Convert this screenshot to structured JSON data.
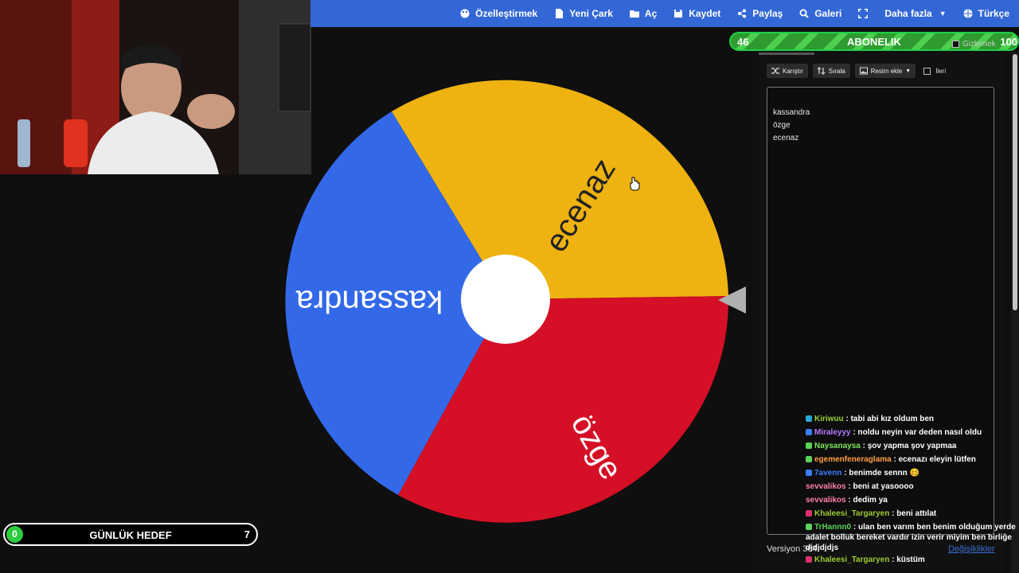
{
  "nav": {
    "items": [
      {
        "label": "Özelleştirmek",
        "icon": "palette-icon"
      },
      {
        "label": "Yeni Çark",
        "icon": "file-icon"
      },
      {
        "label": "Aç",
        "icon": "folder-icon"
      },
      {
        "label": "Kaydet",
        "icon": "save-icon"
      },
      {
        "label": "Paylaş",
        "icon": "share-icon"
      },
      {
        "label": "Galeri",
        "icon": "search-icon"
      },
      {
        "label": "",
        "icon": "fullscreen-icon"
      },
      {
        "label": "Daha fazla",
        "icon": "caret-down-icon"
      },
      {
        "label": "Türkçe",
        "icon": "globe-icon"
      }
    ]
  },
  "subscription": {
    "current": "46",
    "label": "ABONELIK",
    "goal": "100",
    "hide_label": "Gizlemek"
  },
  "toolbar": {
    "shuffle": "Karıştır",
    "sort": "Sırala",
    "add_image": "Resim ekle",
    "advanced": "İleri"
  },
  "wheel": {
    "entries": [
      "kassandra",
      "özge",
      "ecenaz"
    ],
    "colors": {
      "kassandra": "#3369e8",
      "ecenaz": "#eeb211",
      "ozge": "#d50f25",
      "center": "#ffffff",
      "pointer": "#b0b0b0"
    }
  },
  "entries_text": [
    "kassandra",
    "özge",
    "ecenaz"
  ],
  "footer": {
    "version": "Versiyon 364",
    "changes": "Değişiklikler"
  },
  "chat": [
    {
      "user": "Kiriwuu",
      "color": "#9acd32",
      "text": "tabi abi kız oldum ben"
    },
    {
      "user": "Miraleyyy",
      "color": "#b57aff",
      "text": "noldu neyin var deden nasıl oldu"
    },
    {
      "user": "Naysanaysa",
      "color": "#7ce85b",
      "text": "şov yapma şov yapmaa"
    },
    {
      "user": "egemenfeneraglama",
      "color": "#ff9f43",
      "text": "ecenazı eleyin lütfen"
    },
    {
      "user": "7avenn",
      "color": "#3b7dff",
      "text": "benimde sennn 🥴"
    },
    {
      "user": "sevvalikos",
      "color": "#ff7fb0",
      "text": "beni at yasoooo"
    },
    {
      "user": "sevvalikos",
      "color": "#ff7fb0",
      "text": "dedim ya"
    },
    {
      "user": "Khaleesi_Targaryen",
      "color": "#9acd32",
      "text": "beni attılat"
    },
    {
      "user": "TrHannn0",
      "color": "#5bd35b",
      "text": "ulan ben varım ben benim olduğum yerde adalet bolluk bereket vardır izin verir miyim ben birliğe djdjdjdjs"
    },
    {
      "user": "Khaleesi_Targaryen",
      "color": "#9acd32",
      "text": "küstüm"
    }
  ],
  "daily_goal": {
    "current": "0",
    "label": "GÜNLÜK HEDEF",
    "target": "7"
  }
}
